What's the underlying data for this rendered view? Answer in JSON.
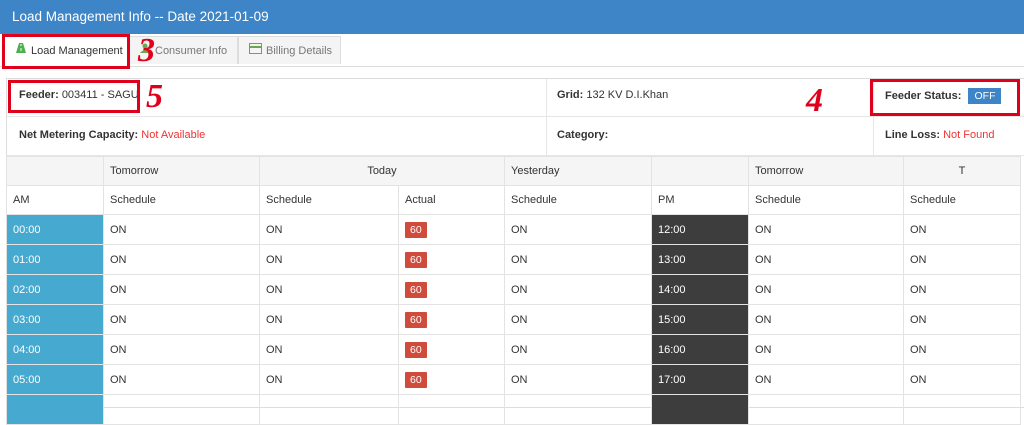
{
  "window": {
    "title": "Load Management Info -- Date 2021-01-09"
  },
  "tabs": [
    {
      "label": "Load Management",
      "icon": "road-icon",
      "active": true
    },
    {
      "label": "Consumer Info",
      "icon": "user-icon",
      "active": false
    },
    {
      "label": "Billing Details",
      "icon": "card-icon",
      "active": false
    }
  ],
  "info": {
    "feeder_label": "Feeder:",
    "feeder_value": "003411 - SAGU",
    "grid_label": "Grid:",
    "grid_value": "132 KV D.I.Khan",
    "status_label": "Feeder Status:",
    "status_value": "OFF",
    "netmeter_label": "Net Metering Capacity:",
    "netmeter_value": "Not Available",
    "category_label": "Category:",
    "category_value": "",
    "lineloss_label": "Line Loss:",
    "lineloss_value": "Not Found"
  },
  "table": {
    "group_headers": [
      "",
      "Tomorrow",
      "Today",
      "Yesterday",
      "",
      "Tomorrow",
      "T"
    ],
    "sub_headers": [
      "AM",
      "Schedule",
      "Schedule",
      "Actual",
      "Schedule",
      "PM",
      "Schedule",
      "Schedule"
    ],
    "rows": [
      {
        "am": "00:00",
        "tom": "ON",
        "tod": "ON",
        "actual": "60",
        "yest": "ON",
        "pm": "12:00",
        "tom2": "ON",
        "tod2": "ON"
      },
      {
        "am": "01:00",
        "tom": "ON",
        "tod": "ON",
        "actual": "60",
        "yest": "ON",
        "pm": "13:00",
        "tom2": "ON",
        "tod2": "ON"
      },
      {
        "am": "02:00",
        "tom": "ON",
        "tod": "ON",
        "actual": "60",
        "yest": "ON",
        "pm": "14:00",
        "tom2": "ON",
        "tod2": "ON"
      },
      {
        "am": "03:00",
        "tom": "ON",
        "tod": "ON",
        "actual": "60",
        "yest": "ON",
        "pm": "15:00",
        "tom2": "ON",
        "tod2": "ON"
      },
      {
        "am": "04:00",
        "tom": "ON",
        "tod": "ON",
        "actual": "60",
        "yest": "ON",
        "pm": "16:00",
        "tom2": "ON",
        "tod2": "ON"
      },
      {
        "am": "05:00",
        "tom": "ON",
        "tod": "ON",
        "actual": "60",
        "yest": "ON",
        "pm": "17:00",
        "tom2": "ON",
        "tod2": "ON"
      },
      {
        "am": "",
        "tom": "",
        "tod": "",
        "actual": "",
        "yest": "",
        "pm": "",
        "tom2": "",
        "tod2": ""
      }
    ]
  },
  "annotations": [
    "3",
    "4",
    "5"
  ],
  "colors": {
    "title_bar": "#3d85c6",
    "am_cell": "#46a9cf",
    "pm_cell": "#3d3d3d",
    "actual_pill": "#cf4b3b",
    "annotation": "#e0001b"
  }
}
